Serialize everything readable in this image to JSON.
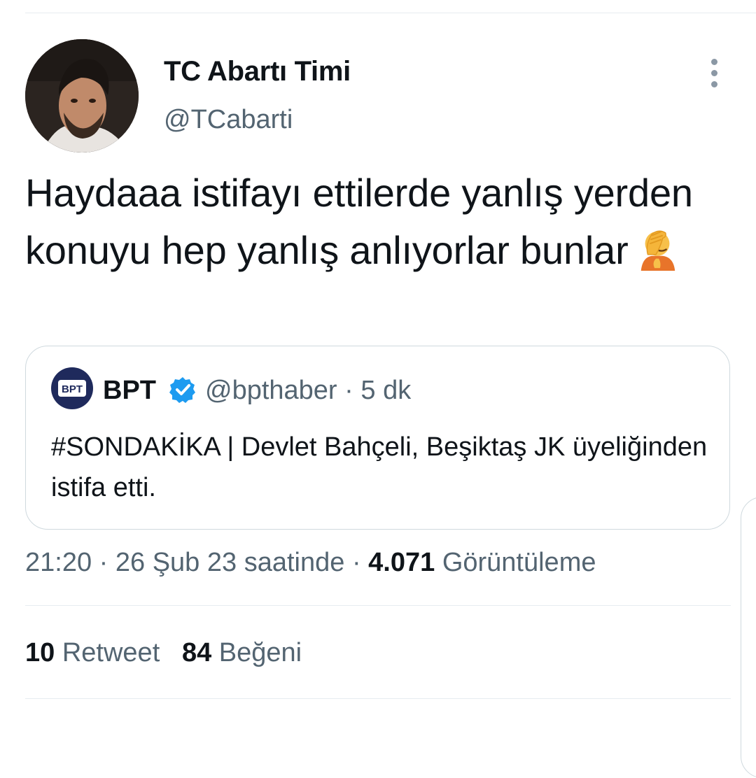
{
  "tweet": {
    "author": {
      "display_name": "TC Abartı Timi",
      "handle": "@TCabarti",
      "avatar_icon": "profile-photo"
    },
    "text": "Haydaaa istifayı ettilerde yanlış yerden konuyu hep yanlış anlıyorlar bunlar",
    "emoji_icon": "facepalm-emoji",
    "quoted": {
      "display_name": "BPT",
      "verified_icon": "verified-badge-icon",
      "handle": "@bpthaber",
      "separator": "·",
      "time_ago": "5 dk",
      "text": "#SONDAKİKA | Devlet Bahçeli, Beşiktaş JK üyeliğinden istifa etti."
    },
    "timestamp": {
      "time": "21:20",
      "separator1": "·",
      "date": "26 Şub 23 saatinde",
      "separator2": "·",
      "views_count": "4.071",
      "views_label": "Görüntüleme"
    },
    "stats": {
      "retweets_count": "10",
      "retweets_label": "Retweet",
      "likes_count": "84",
      "likes_label": "Beğeni"
    }
  },
  "colors": {
    "text_primary": "#0f1419",
    "text_secondary": "#536471",
    "verified_blue": "#1d9bf0",
    "divider": "#e6ecf0"
  }
}
